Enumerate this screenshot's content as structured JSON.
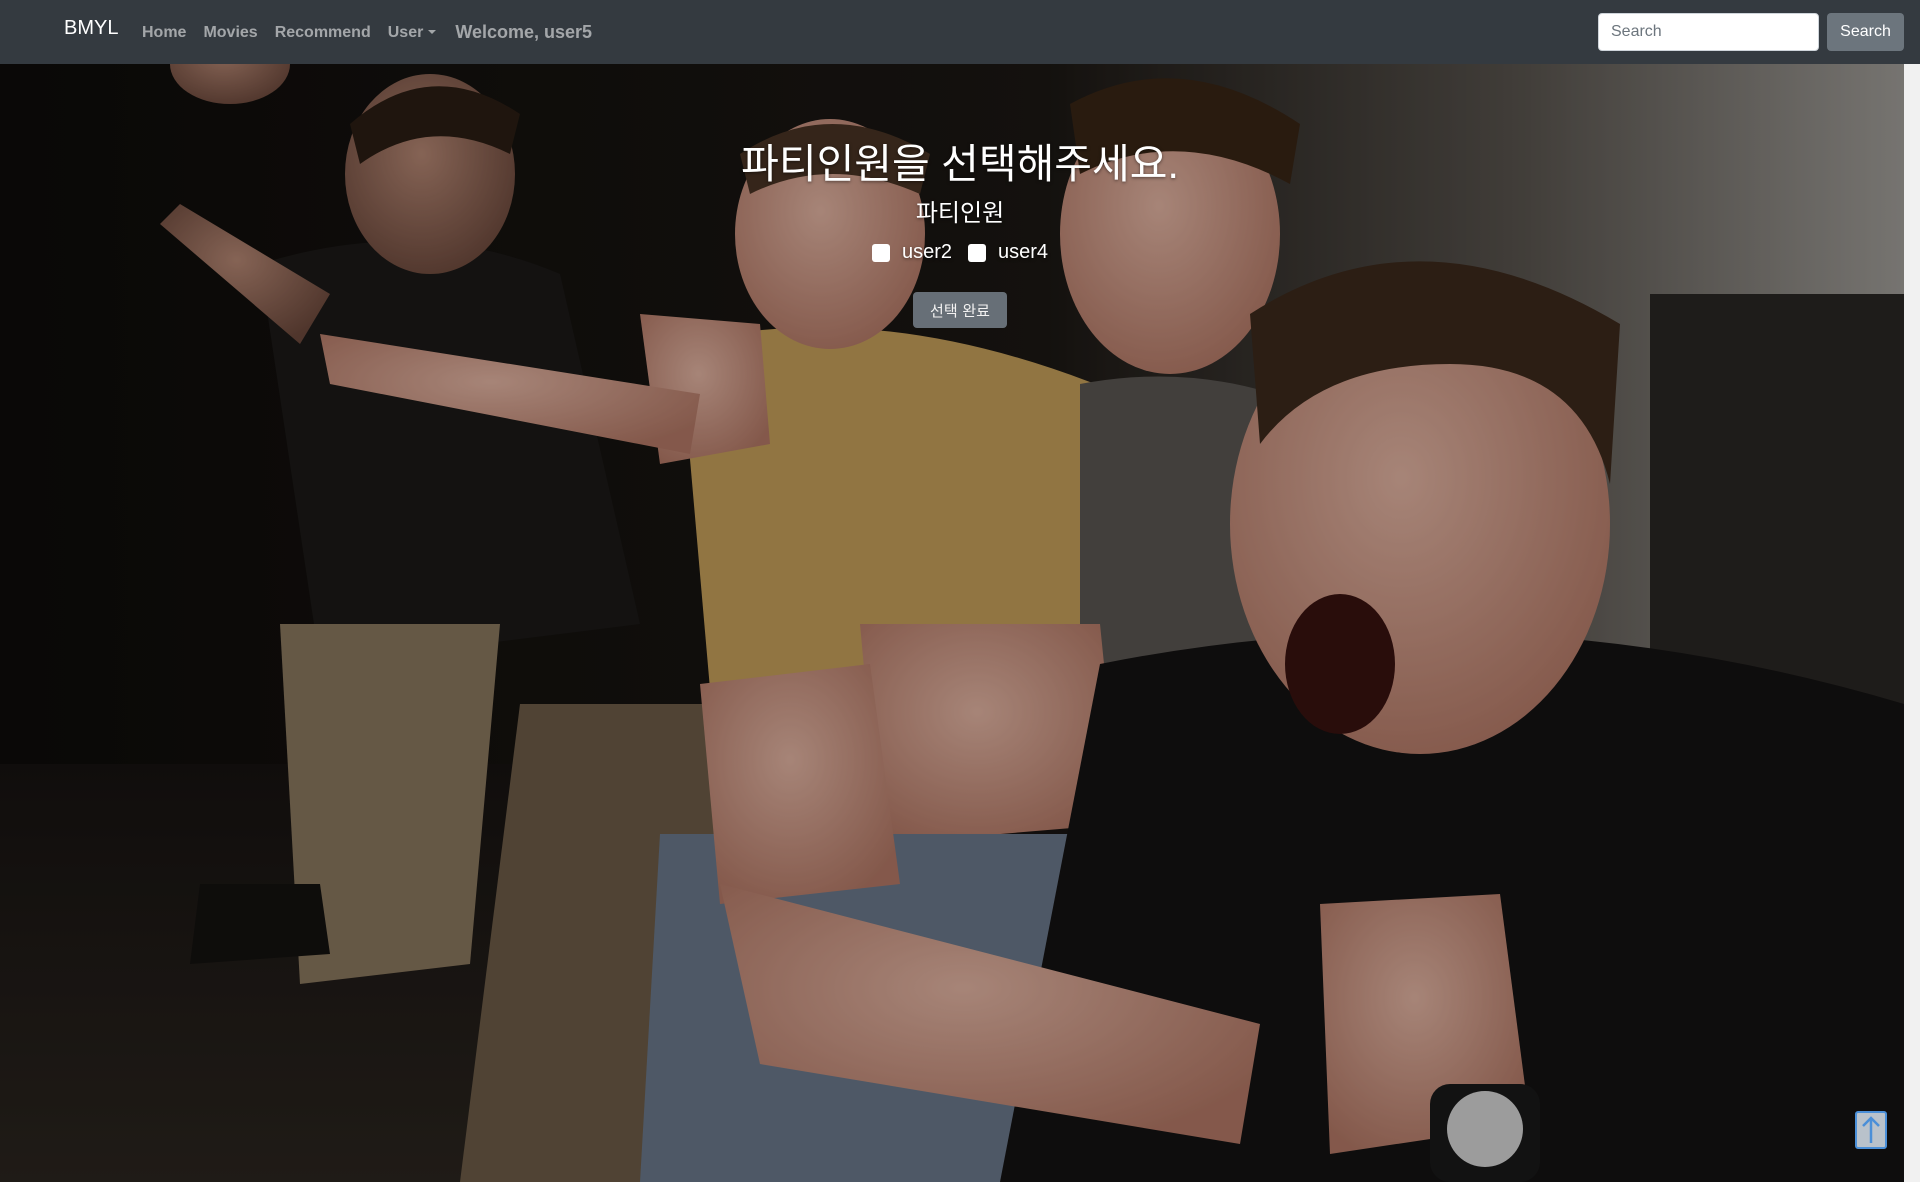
{
  "navbar": {
    "brand": "BMYL",
    "links": {
      "home": "Home",
      "movies": "Movies",
      "recommend": "Recommend",
      "user": "User"
    },
    "welcome": "Welcome, user5",
    "search": {
      "placeholder": "Search",
      "button_label": "Search"
    }
  },
  "party": {
    "heading": "파티인원을 선택해주세요.",
    "subheading": "파티인원",
    "members": [
      {
        "label": "user2",
        "checked": false
      },
      {
        "label": "user4",
        "checked": false
      }
    ],
    "confirm_label": "선택 완료"
  },
  "hero": {
    "image": "four men excitedly cheering and pointing at a screen",
    "overlay_color": "#000000"
  },
  "colors": {
    "navbar_bg": "#343a40",
    "button_secondary": "#6c757d",
    "scroll_top_accent": "#4a8fd8"
  },
  "icons": {
    "scroll_top": "arrow-up-icon",
    "user_dropdown": "caret-down-icon"
  }
}
